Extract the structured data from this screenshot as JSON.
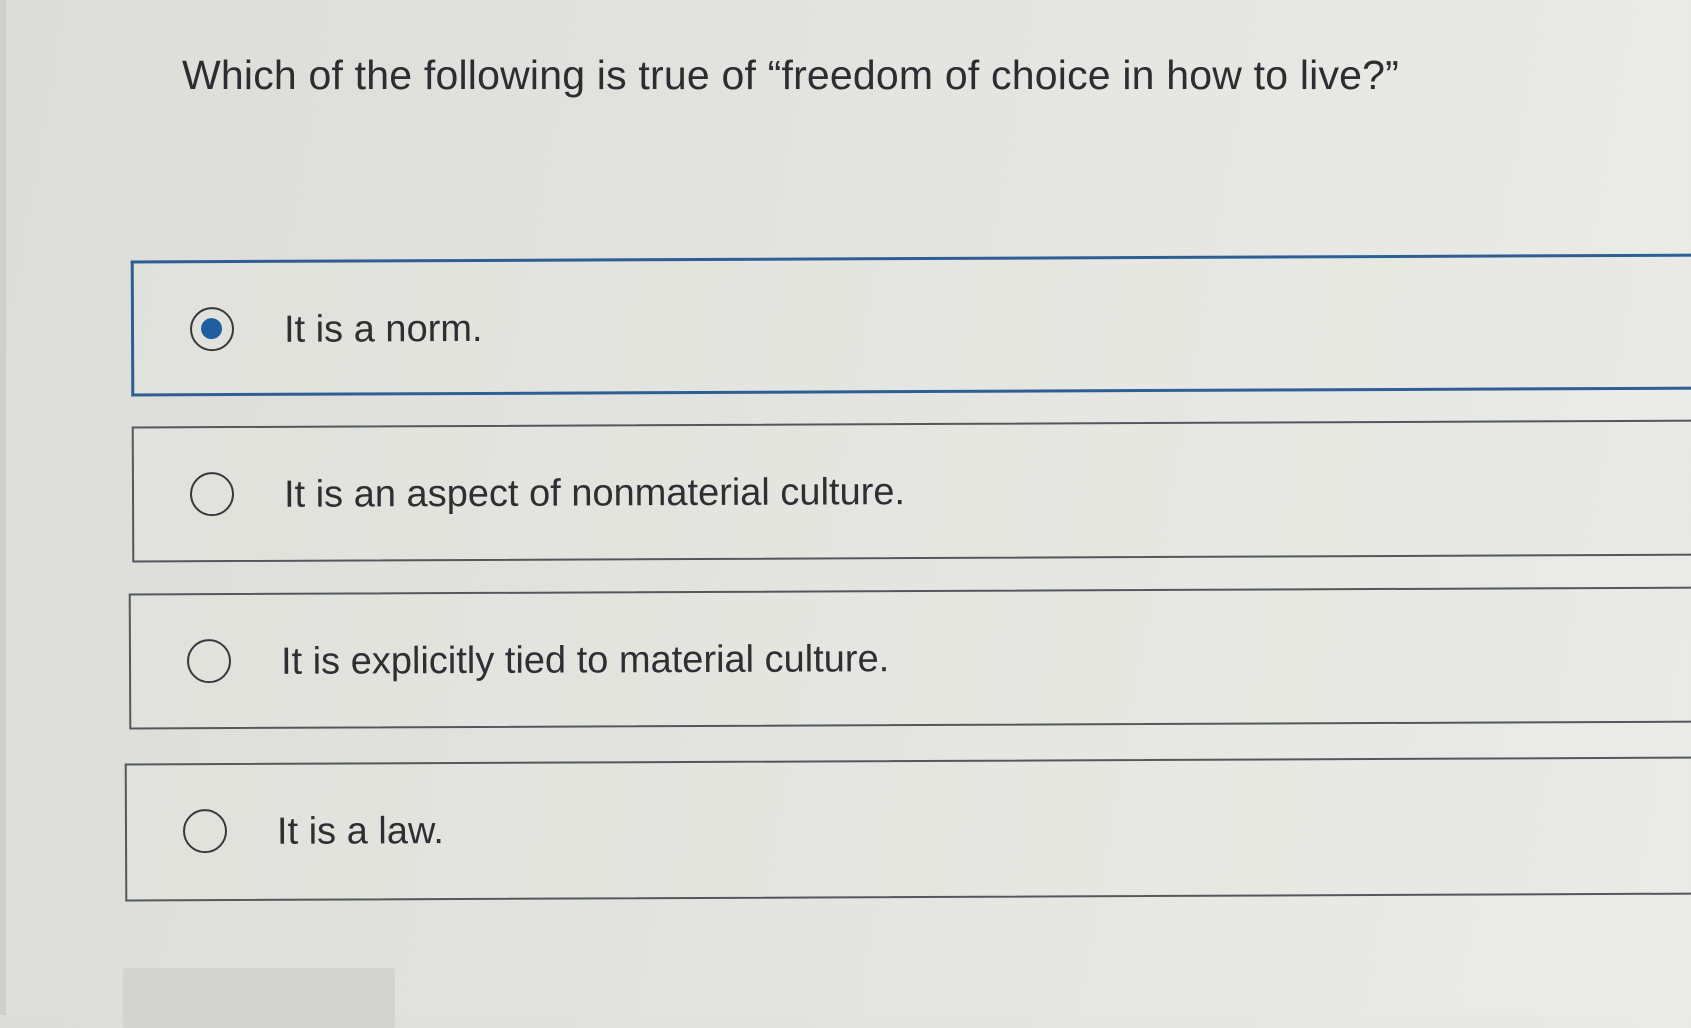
{
  "question": {
    "text": "Which of the following is true of “freedom of choice in how to live?”"
  },
  "options": [
    {
      "label": "It is a norm.",
      "selected": true
    },
    {
      "label": "It is an aspect of nonmaterial culture.",
      "selected": false
    },
    {
      "label": "It is explicitly tied to material culture.",
      "selected": false
    },
    {
      "label": "It is a law.",
      "selected": false
    }
  ],
  "colors": {
    "selected_border": "#2d5f95",
    "selected_dot": "#1f5f9f",
    "text": "#2f2f33"
  }
}
